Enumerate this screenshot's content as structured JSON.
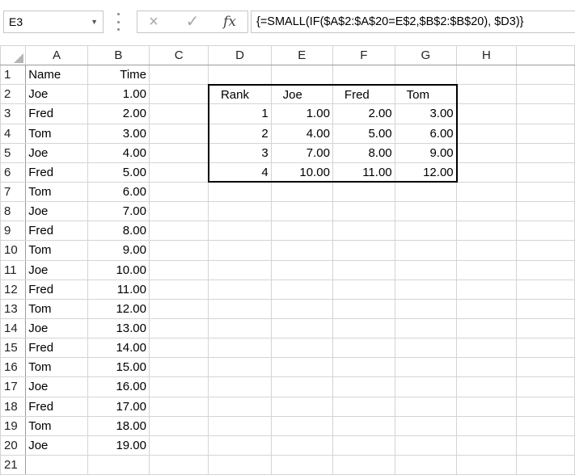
{
  "formula_bar": {
    "name_box": "E3",
    "cancel_icon": "×",
    "enter_icon": "✓",
    "fx_label": "fx",
    "formula": "{=SMALL(IF($A$2:$A$20=E$2,$B$2:$B$20), $D3)}"
  },
  "columns": [
    "A",
    "B",
    "C",
    "D",
    "E",
    "F",
    "G",
    "H",
    ""
  ],
  "row_numbers": [
    "1",
    "2",
    "3",
    "4",
    "5",
    "6",
    "7",
    "8",
    "9",
    "10",
    "11",
    "12",
    "13",
    "14",
    "15",
    "16",
    "17",
    "18",
    "19",
    "20",
    "21"
  ],
  "data_table": {
    "headers": [
      "Name",
      "Time"
    ],
    "rows": [
      [
        "Joe",
        "1.00"
      ],
      [
        "Fred",
        "2.00"
      ],
      [
        "Tom",
        "3.00"
      ],
      [
        "Joe",
        "4.00"
      ],
      [
        "Fred",
        "5.00"
      ],
      [
        "Tom",
        "6.00"
      ],
      [
        "Joe",
        "7.00"
      ],
      [
        "Fred",
        "8.00"
      ],
      [
        "Tom",
        "9.00"
      ],
      [
        "Joe",
        "10.00"
      ],
      [
        "Fred",
        "11.00"
      ],
      [
        "Tom",
        "12.00"
      ],
      [
        "Joe",
        "13.00"
      ],
      [
        "Fred",
        "14.00"
      ],
      [
        "Tom",
        "15.00"
      ],
      [
        "Joe",
        "16.00"
      ],
      [
        "Fred",
        "17.00"
      ],
      [
        "Tom",
        "18.00"
      ],
      [
        "Joe",
        "19.00"
      ]
    ]
  },
  "rank_table": {
    "headers": [
      "Rank",
      "Joe",
      "Fred",
      "Tom"
    ],
    "rows": [
      [
        "1",
        "1.00",
        "2.00",
        "3.00"
      ],
      [
        "2",
        "4.00",
        "5.00",
        "6.00"
      ],
      [
        "3",
        "7.00",
        "8.00",
        "9.00"
      ],
      [
        "4",
        "10.00",
        "11.00",
        "12.00"
      ]
    ]
  }
}
